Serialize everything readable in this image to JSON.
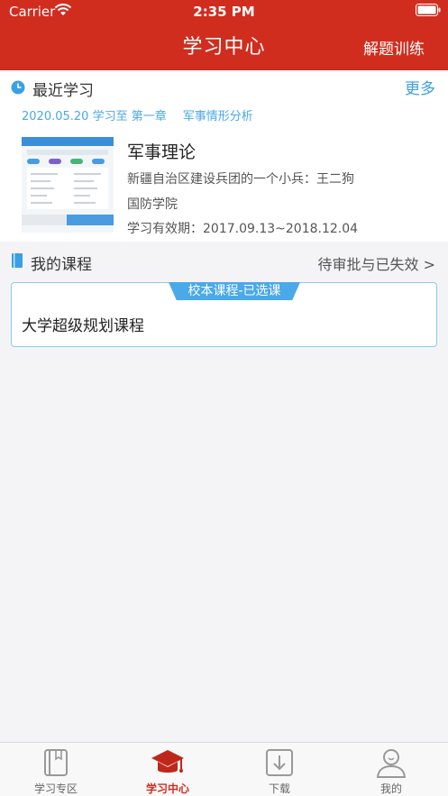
{
  "status_bar": {
    "carrier": "Carrier",
    "time": "2:35 PM"
  },
  "nav": {
    "title": "学习中心",
    "right_action": "解题训练"
  },
  "recent": {
    "title": "最近学习",
    "more": "更多",
    "meta_date": "2020.05.20 学习至 第一章",
    "meta_topic": "军事情形分析",
    "course": {
      "title": "军事理论",
      "author": "新疆自治区建设兵团的一个小兵：王二狗",
      "school": "国防学院",
      "validity": "学习有效期：2017.09.13~2018.12.04"
    }
  },
  "my_courses": {
    "title": "我的课程",
    "link": "待审批与已失效 >",
    "items": [
      {
        "tag": "校本课程-已选课",
        "name": "大学超级规划课程"
      }
    ]
  },
  "tabbar": {
    "items": [
      {
        "label": "学习专区",
        "icon": "book-icon"
      },
      {
        "label": "学习中心",
        "icon": "graduation-cap-icon",
        "active": true
      },
      {
        "label": "下载",
        "icon": "download-icon"
      },
      {
        "label": "我的",
        "icon": "user-icon"
      }
    ]
  },
  "colors": {
    "brand": "#d12d1f",
    "accent": "#3aa0e6"
  }
}
